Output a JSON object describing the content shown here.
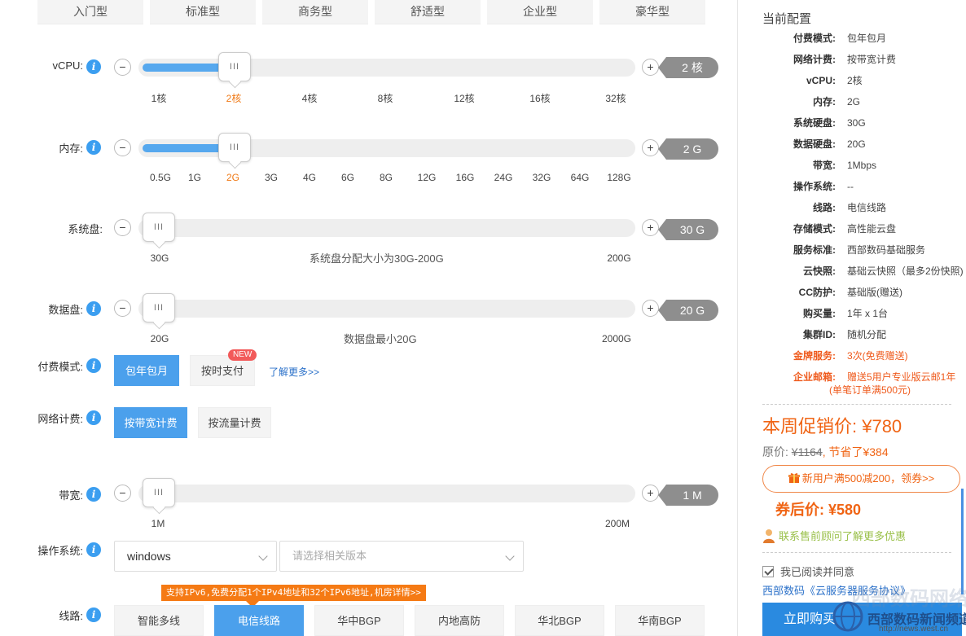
{
  "presets": [
    "入门型",
    "标准型",
    "商务型",
    "舒适型",
    "企业型",
    "豪华型"
  ],
  "info_glyph": "i",
  "minus_glyph": "−",
  "plus_glyph": "+",
  "handle_glyph": "III",
  "vcpu": {
    "label": "vCPU:",
    "value_tag": "2 核",
    "ticks": [
      "1核",
      "2核",
      "4核",
      "8核",
      "12核",
      "16核",
      "32核"
    ],
    "active_tick": "2核",
    "level_fraction": 0.19
  },
  "memory": {
    "label": "内存:",
    "value_tag": "2 G",
    "ticks": [
      "0.5G",
      "1G",
      "2G",
      "3G",
      "4G",
      "6G",
      "8G",
      "12G",
      "16G",
      "24G",
      "32G",
      "64G",
      "128G"
    ],
    "active_tick": "2G",
    "level_fraction": 0.19
  },
  "system_disk": {
    "label": "系统盘:",
    "value_tag": "30 G",
    "min": "30G",
    "max": "200G",
    "hint": "系统盘分配大小为30G-200G"
  },
  "data_disk": {
    "label": "数据盘:",
    "value_tag": "20 G",
    "min": "20G",
    "max": "2000G",
    "hint": "数据盘最小20G"
  },
  "billing": {
    "label": "付费模式:",
    "options": [
      "包年包月",
      "按时支付"
    ],
    "selected": "包年包月",
    "new_badge": "NEW",
    "more_link": "了解更多>>"
  },
  "network": {
    "label": "网络计费:",
    "options": [
      "按带宽计费",
      "按流量计费"
    ],
    "selected": "按带宽计费"
  },
  "bandwidth": {
    "label": "带宽:",
    "value_tag": "1 M",
    "min": "1M",
    "max": "200M"
  },
  "os": {
    "label": "操作系统:",
    "value": "windows",
    "version_placeholder": "请选择相关版本"
  },
  "line": {
    "label": "线路:",
    "tooltip": "支持IPv6,免费分配1个IPv4地址和32个IPv6地址,机房详情>>",
    "options": [
      "智能多线",
      "电信线路",
      "华中BGP",
      "内地高防",
      "华北BGP",
      "华南BGP"
    ],
    "selected": "电信线路"
  },
  "panel": {
    "title": "当前配置",
    "config": [
      {
        "k": "付费模式:",
        "v": "包年包月"
      },
      {
        "k": "网络计费:",
        "v": "按带宽计费"
      },
      {
        "k": "vCPU:",
        "v": "2核"
      },
      {
        "k": "内存:",
        "v": "2G"
      },
      {
        "k": "系统硬盘:",
        "v": "30G"
      },
      {
        "k": "数据硬盘:",
        "v": "20G"
      },
      {
        "k": "带宽:",
        "v": "1Mbps"
      },
      {
        "k": "操作系统:",
        "v": "--"
      },
      {
        "k": "线路:",
        "v": "电信线路"
      },
      {
        "k": "存储模式:",
        "v": "高性能云盘"
      },
      {
        "k": "服务标准:",
        "v": "西部数码基础服务"
      },
      {
        "k": "云快照:",
        "v": "基础云快照（最多2份快照)"
      },
      {
        "k": "CC防护:",
        "v": "基础版(赠送)"
      },
      {
        "k": "购买量:",
        "v": "1年 x 1台"
      },
      {
        "k": "集群ID:",
        "v": "随机分配"
      },
      {
        "k": "金牌服务:",
        "v": "3次(免费赠送)"
      },
      {
        "k": "企业邮箱:",
        "v": "赠送5用户专业版云邮1年"
      }
    ],
    "email_note": "(单笔订单满500元)",
    "promo_label": "本周促销价: ¥780",
    "orig_prefix": "原价: ",
    "orig_price": "¥1164",
    "saved": ", 节省了¥384",
    "coupon": "新用户满500减200，领券>>",
    "after_coupon": "券后价: ¥580",
    "consult": "联系售前顾问了解更多优惠",
    "agree": "我已阅读并同意",
    "agree_link": "西部数码《云服务器服务协议》",
    "buy": "立即购买",
    "colors": {
      "accent": "#4ba0ec",
      "promo": "#f06414",
      "buy": "#2a8ae0"
    }
  },
  "watermark": {
    "bg_text": "西部数码网络",
    "text": "西部数码新闻频道",
    "url": "http://news.west.cn"
  }
}
